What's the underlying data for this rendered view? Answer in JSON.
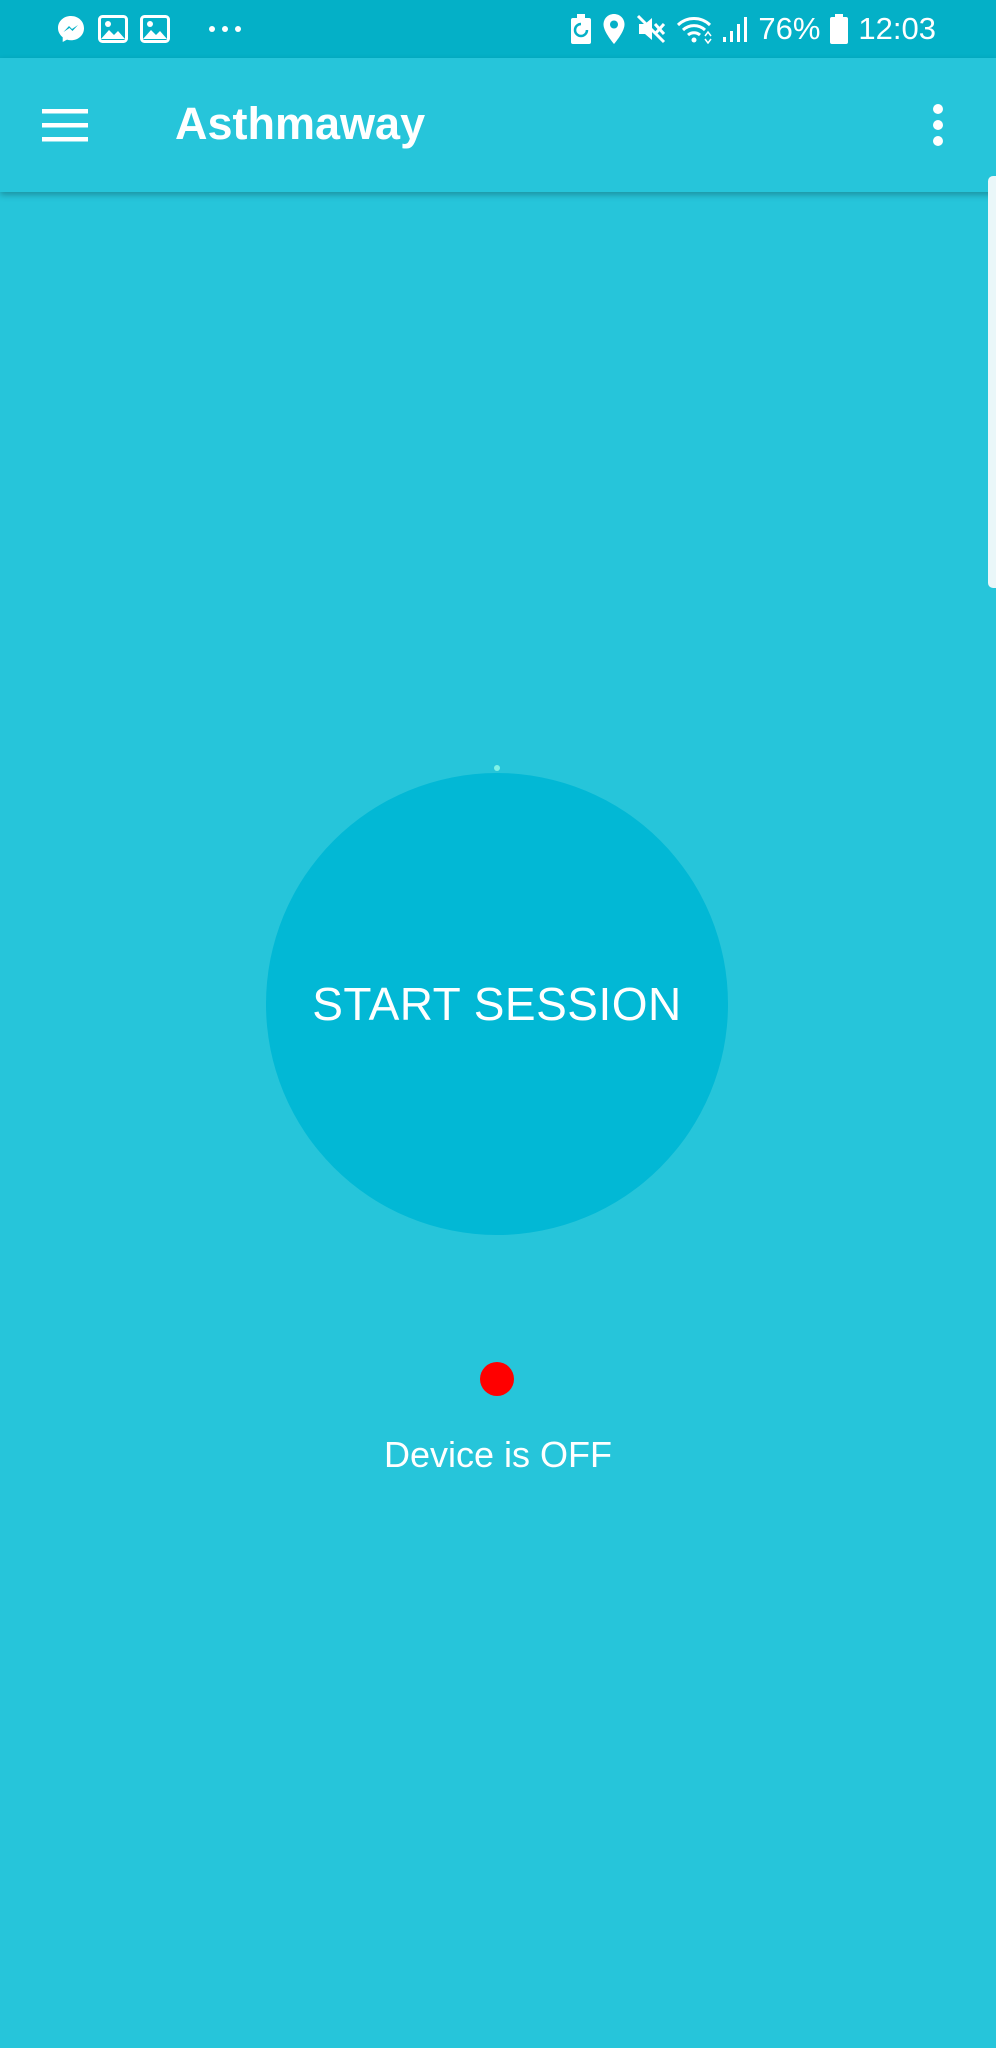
{
  "status_bar": {
    "left_icons": [
      "messenger-icon",
      "gallery-icon",
      "gallery-icon",
      "more-notifications-icon"
    ],
    "right_icons": [
      "battery-saver-icon",
      "location-icon",
      "mute-icon",
      "wifi-icon",
      "signal-icon",
      "battery-icon"
    ],
    "battery": "76%",
    "time": "12:03"
  },
  "app_bar": {
    "title": "Asthmaway",
    "menu_icon": "hamburger-menu-icon",
    "overflow_icon": "more-vert-icon"
  },
  "main": {
    "session_button_label": "START SESSION",
    "device_status_text": "Device is OFF",
    "device_status_color": "#ff0000"
  },
  "colors": {
    "background": "#26c5da",
    "status_bar": "#04b0c7",
    "session_circle": "#02b8d5"
  }
}
